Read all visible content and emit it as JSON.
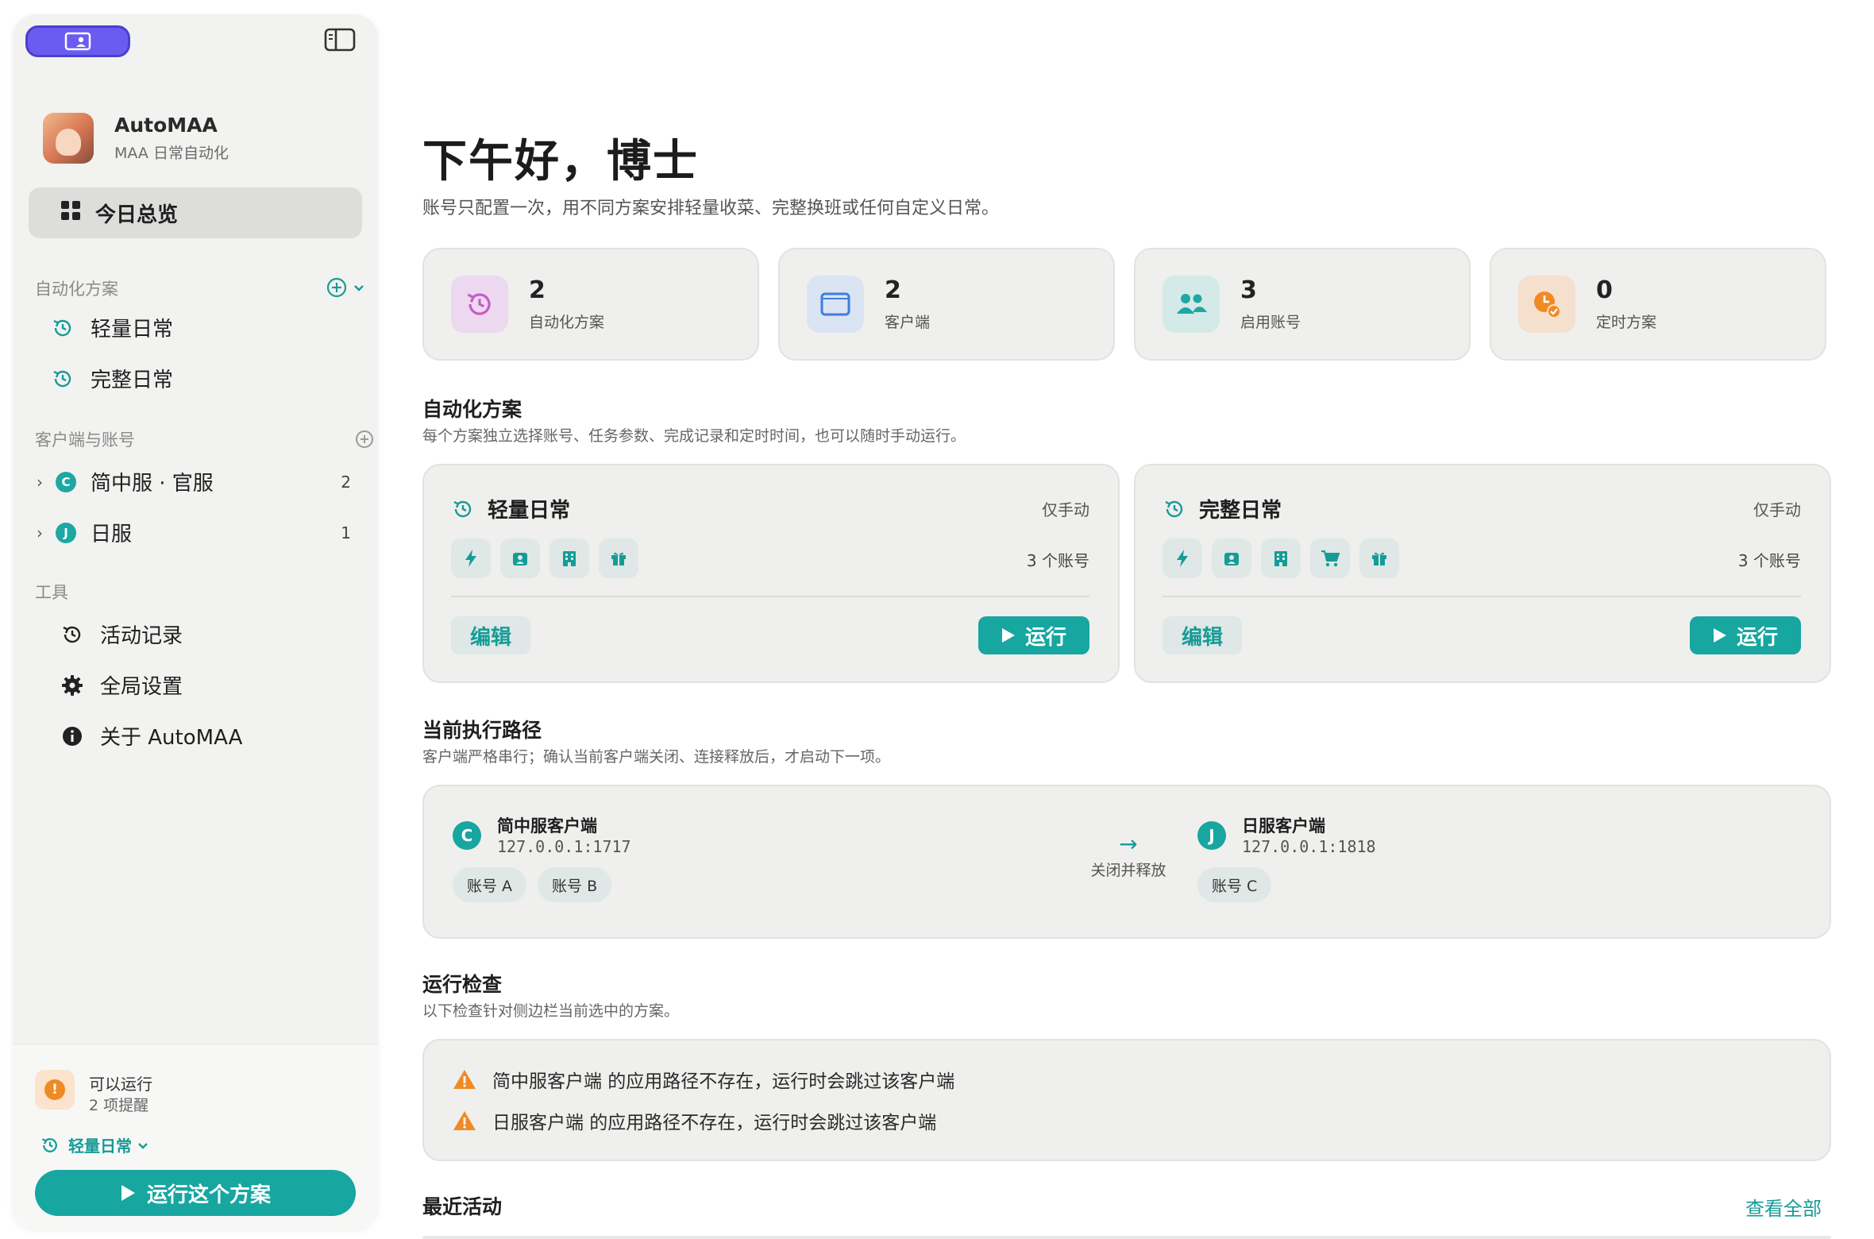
{
  "brand": {
    "name": "AutoMAA",
    "subtitle": "MAA 日常自动化"
  },
  "sidebar": {
    "overview": "今日总览",
    "plans_section": "自动化方案",
    "plans": [
      {
        "label": "轻量日常"
      },
      {
        "label": "完整日常"
      }
    ],
    "clients_section": "客户端与账号",
    "clients": [
      {
        "badge": "C",
        "label": "简中服 · 官服",
        "count": "2"
      },
      {
        "badge": "J",
        "label": "日服",
        "count": "1"
      }
    ],
    "tools_section": "工具",
    "tools": [
      {
        "label": "活动记录",
        "icon": "history-icon"
      },
      {
        "label": "全局设置",
        "icon": "gear-icon"
      },
      {
        "label": "关于 AutoMAA",
        "icon": "info-icon"
      }
    ],
    "footer": {
      "status": "可以运行",
      "reminders": "2 项提醒",
      "selected_plan": "轻量日常",
      "run_button": "运行这个方案"
    }
  },
  "main": {
    "greeting": "下午好，博士",
    "greeting_sub": "账号只配置一次，用不同方案安排轻量收菜、完整换班或任何自定义日常。",
    "stats": [
      {
        "value": "2",
        "label": "自动化方案",
        "icon": "history-icon",
        "color": "#c65bc7"
      },
      {
        "value": "2",
        "label": "客户端",
        "icon": "window-icon",
        "color": "#3e7ee0"
      },
      {
        "value": "3",
        "label": "启用账号",
        "icon": "users-icon",
        "color": "#1ea8a3"
      },
      {
        "value": "0",
        "label": "定时方案",
        "icon": "clock-check-icon",
        "color": "#f08a24"
      }
    ],
    "plans_heading": "自动化方案",
    "plans_sub": "每个方案独立选择账号、任务参数、完成记录和定时时间，也可以随时手动运行。",
    "plan_cards": [
      {
        "title": "轻量日常",
        "trigger": "仅手动",
        "accounts": "3 个账号",
        "edit": "编辑",
        "run": "运行",
        "tasks": [
          "bolt-icon",
          "recruit-icon",
          "building-icon",
          "gift-icon"
        ]
      },
      {
        "title": "完整日常",
        "trigger": "仅手动",
        "accounts": "3 个账号",
        "edit": "编辑",
        "run": "运行",
        "tasks": [
          "bolt-icon",
          "recruit-icon",
          "building-icon",
          "cart-icon",
          "gift-icon"
        ]
      }
    ],
    "path_heading": "当前执行路径",
    "path_sub": "客户端严格串行；确认当前客户端关闭、连接释放后，才启动下一项。",
    "path": {
      "from": {
        "badge": "C",
        "name": "简中服客户端",
        "addr": "127.0.0.1:1717",
        "accounts": [
          "账号 A",
          "账号 B"
        ]
      },
      "transfer": "关闭并释放",
      "to": {
        "badge": "J",
        "name": "日服客户端",
        "addr": "127.0.0.1:1818",
        "accounts": [
          "账号 C"
        ]
      }
    },
    "check_heading": "运行检查",
    "check_sub": "以下检查针对侧边栏当前选中的方案。",
    "checks": [
      "简中服客户端 的应用路径不存在，运行时会跳过该客户端",
      "日服客户端 的应用路径不存在，运行时会跳过该客户端"
    ],
    "recent_heading": "最近活动",
    "view_all": "查看全部"
  },
  "colors": {
    "accent": "#17a6a0",
    "warning": "#f08a24",
    "pill": "#6a5cf0"
  }
}
